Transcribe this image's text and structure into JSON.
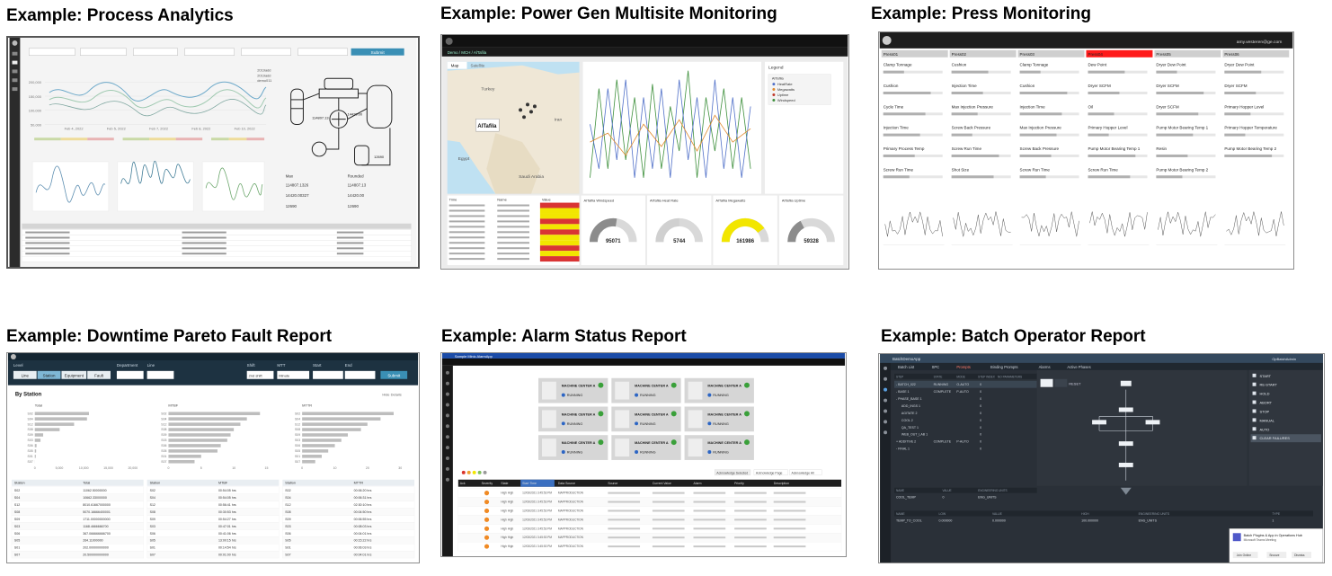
{
  "cards": [
    {
      "title": "Example:  Process Analytics"
    },
    {
      "title": "Example: Power Gen Multisite Monitoring"
    },
    {
      "title": "Example: Press Monitoring"
    },
    {
      "title": "Example: Downtime Pareto Fault Report"
    },
    {
      "title": "Example: Alarm Status Report"
    },
    {
      "title": "Example: Batch Operator Report"
    }
  ],
  "process_analytics": {
    "submit_label": "Submit",
    "legend": [
      "2019add",
      "2019add",
      "demo011"
    ],
    "yaxis": [
      "200,000",
      "150,000",
      "100,000",
      "50,000",
      "0"
    ],
    "xaxis": [
      "Feb 4, 2022",
      "Feb 5, 2022",
      "Feb 7, 2022",
      "Feb 8, 2022",
      "Feb 10, 2022"
    ],
    "max_label": "Max",
    "rounded_label": "Rounded",
    "values": [
      "114807.1326",
      "114807.13",
      "14420.00327",
      "14420.00",
      "12690",
      "12690"
    ],
    "tag_labels": [
      "114807.13",
      "14420.00",
      "12690"
    ]
  },
  "power_gen": {
    "breadcrumb": "Demo / MCH / AlTafila",
    "map_tabs": [
      "Map",
      "Satellite"
    ],
    "map_labels": [
      "Turkey",
      "Iran",
      "Egypt",
      "Saudi Arabia"
    ],
    "selected_site": "AlTafila",
    "legend_title": "Legend",
    "legend_items": [
      "AlTafila",
      "HeatRate",
      "Megawatts",
      "Uptime",
      "Windspeed"
    ],
    "table_headers": [
      "Time",
      "Name",
      "Value"
    ],
    "gauges": [
      {
        "title": "AlTafila Windspeed",
        "value": "95071",
        "fill": 0.55,
        "color": "#8c8c8c"
      },
      {
        "title": "AlTafila Heat Rate",
        "value": "5744",
        "fill": 0.5,
        "color": "#d0d0d0"
      },
      {
        "title": "AlTafila Megawatts",
        "value": "161986",
        "fill": 0.8,
        "color": "#f2e600"
      },
      {
        "title": "AlTafila Uptime",
        "value": "59328",
        "fill": 0.35,
        "color": "#8c8c8c"
      }
    ]
  },
  "press": {
    "user": "amy.vesteren@ge.com",
    "columns": [
      {
        "name": "Press01",
        "alarm": false,
        "metrics": [
          "Clamp Tonnage",
          "Cushion",
          "Cycle Time",
          "Injection Time",
          "Primary Process Temp",
          "Screw Run Time"
        ]
      },
      {
        "name": "Press02",
        "alarm": false,
        "metrics": [
          "Cushion",
          "Injection Time",
          "Max Injection Pressure",
          "Screw Back Pressure",
          "Screw Run Time",
          "Shot Size"
        ]
      },
      {
        "name": "Press03",
        "alarm": false,
        "metrics": [
          "Clamp Tonnage",
          "Cushion",
          "Injection Time",
          "Max Injection Pressure",
          "Screw Back Pressure",
          "Screw Run Time"
        ]
      },
      {
        "name": "Press04",
        "alarm": true,
        "metrics": [
          "Dew Point",
          "Dryer SCFM",
          "Oil",
          "Primary Hopper Level",
          "Pump Motor Bearing Temp 1",
          "Screw Run Time"
        ]
      },
      {
        "name": "Press05",
        "alarm": false,
        "metrics": [
          "Dryer Dew Point",
          "Dryer SCFM",
          "Dryer SCFM",
          "Pump Motor Bearing Temp 1",
          "Resin",
          "Pump Motor Bearing Temp 2"
        ]
      },
      {
        "name": "Press06",
        "alarm": false,
        "metrics": [
          "Dryer Dew Point",
          "Dryer SCFM",
          "Primary Hopper Level",
          "Primary Hopper Temperature",
          "Pump Motor Bearing Temp 2"
        ]
      }
    ]
  },
  "downtime": {
    "labels": [
      "Level",
      "Department",
      "Line",
      "Shift",
      "MTT",
      "Start",
      "End"
    ],
    "level_tabs": [
      "Line",
      "Station",
      "Equipment",
      "Fault"
    ],
    "shift_value": "2nd shift",
    "mtt_value": "Minute",
    "submit_label": "Submit",
    "section_title": "By Station",
    "hide_label": "Hide Details",
    "chart_titles": [
      "Total",
      "MTBF",
      "MTTR"
    ],
    "total_ticks": [
      "0",
      "5,000",
      "10,000",
      "15,000",
      "20,000"
    ],
    "mtbf_ticks": [
      "0",
      "5",
      "10",
      "15"
    ],
    "mttr_ticks": [
      "0",
      "10",
      "20",
      "30"
    ],
    "table_headers": [
      [
        "Station",
        "Total"
      ],
      [
        "Station",
        "MTBF"
      ],
      [
        "Station",
        "MTTR"
      ]
    ],
    "total_rows": [
      [
        "S02",
        "11062.50000000"
      ],
      [
        "S04",
        "10662.33000000"
      ],
      [
        "S12",
        "8010.61667000000"
      ],
      [
        "S08",
        "5070.16666400001"
      ],
      [
        "S09",
        "1711.00000000000"
      ],
      [
        "S03",
        "1168.4666666700"
      ],
      [
        "S06",
        "367.066666666700"
      ],
      [
        "S05",
        "264.11000000"
      ],
      [
        "S01",
        "202.00000000000"
      ],
      [
        "S07",
        "20.500000000000"
      ]
    ],
    "mtbf_rows": [
      [
        "S02",
        "00:54:05 hrs"
      ],
      [
        "S04",
        "00:54:05 hrs"
      ],
      [
        "S12",
        "00:56:41 hrs"
      ],
      [
        "S08",
        "00:30:53 hrs"
      ],
      [
        "S09",
        "00:54:27 hrs"
      ],
      [
        "S03",
        "00:47:01 hrs"
      ],
      [
        "S06",
        "00:41:06 hrs"
      ],
      [
        "S05",
        "13:00:15 hrs"
      ],
      [
        "S01",
        "00:14:54 hrs"
      ],
      [
        "S07",
        "00:01:00 hrs"
      ]
    ],
    "mttr_rows": [
      [
        "S02",
        "00:06:20 hrs"
      ],
      [
        "S04",
        "00:06:31 hrs"
      ],
      [
        "S12",
        "02:30:10 hrs"
      ],
      [
        "S08",
        "00:04:50 hrs"
      ],
      [
        "S09",
        "00:06:55 hrs"
      ],
      [
        "S03",
        "00:08:03 hrs"
      ],
      [
        "S06",
        "00:04:01 hrs"
      ],
      [
        "S05",
        "00:15:22 hrs"
      ],
      [
        "S01",
        "00:06:03 hrs"
      ],
      [
        "S07",
        "00:04:01 hrs"
      ]
    ]
  },
  "alarm_status": {
    "app_title": "Sample Minic AlarmApp",
    "machine_name": "MACHINE CENTER A",
    "machine_state": "RUNNING",
    "buttons": [
      "Acknowledge Selected",
      "Acknowledge Page",
      "Acknowledge All"
    ],
    "table_headers": [
      "Ack",
      "Severity",
      "State",
      "Start Time",
      "Data Source",
      "Source",
      "Current Value",
      "Alarm",
      "Priority",
      "Description"
    ],
    "row_template": {
      "state": "High High",
      "start": "12/03/2021 3:45:53 PM",
      "source_type": "MAPPRODUCTION"
    },
    "row_count": 7
  },
  "batch": {
    "app_title": "BatchDemoApp",
    "user": "OpBatchAdmin",
    "tabs": [
      "Batch List",
      "SPC",
      "Prompts",
      "Binding Prompts",
      "Alarms",
      "Active Phases"
    ],
    "table_headers": [
      "STEP",
      "STATE",
      "MODE",
      "STEP INDEX",
      "NO PARAMETERS"
    ],
    "rows": [
      [
        "- BATCH_022",
        "RUNNING",
        "O-AUTO",
        "0"
      ],
      [
        "- BASE 1",
        "COMPLETE",
        "P-AUTO",
        "0"
      ],
      [
        "- PHASE_BASE 1",
        "",
        "",
        "0"
      ],
      [
        "ADD_INGS 1",
        "",
        "",
        "0"
      ],
      [
        "AGITATE 2",
        "",
        "",
        "0"
      ],
      [
        "COOL 2",
        "",
        "",
        "0"
      ],
      [
        "QA_TEST 1",
        "",
        "",
        "0"
      ],
      [
        "WEB_OUT_LAB 1",
        "",
        "",
        "0"
      ],
      [
        "+ ADDITIVE 2",
        "COMPLETE",
        "P-AUTO",
        "0"
      ],
      [
        "- FINAL 1",
        "",
        "",
        "0"
      ]
    ],
    "commands": [
      "START",
      "RE-START",
      "HOLD",
      "ABORT",
      "STOP",
      "MANUAL",
      "AUTO",
      "CLEAR FAILURES"
    ],
    "reset_label": "RESET",
    "param_headers": [
      "NAME",
      "VALUE",
      "ENGINEERING UNITS"
    ],
    "param_row": [
      "COOL_TEMP",
      "0",
      "ENG_UNITS"
    ],
    "bottom_headers": [
      "NAME",
      "LOW",
      "VALUE",
      "HIGH",
      "ENGINEERING UNITS",
      "TYPE"
    ],
    "bottom_row": [
      "TEMP_TO_COOL",
      "0.000000",
      "0.000000",
      "100.000000",
      "ENG_UNITS",
      "1"
    ],
    "toast_title": "Batch Plugins & App in Operations Hub",
    "toast_sub": "Microsoft Teams Meeting",
    "toast_actions": [
      "Join Online",
      "Snooze",
      "Dismiss"
    ]
  }
}
